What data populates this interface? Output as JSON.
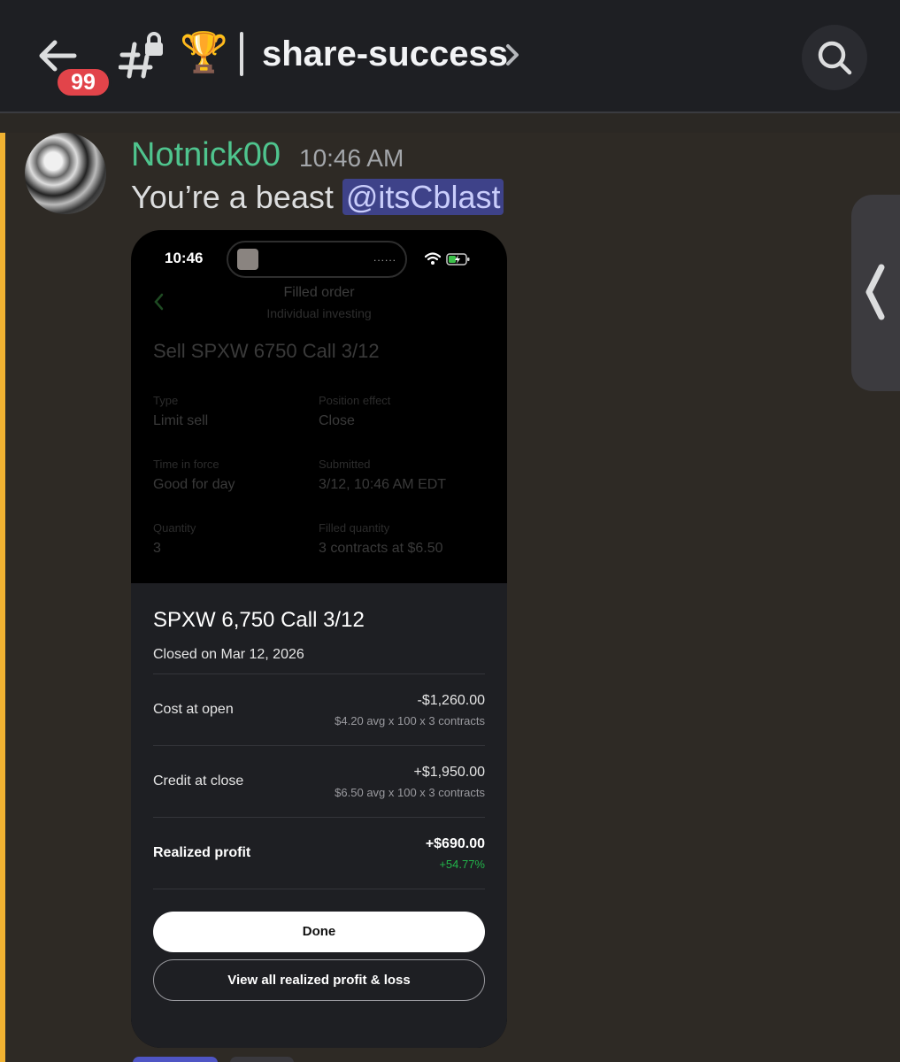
{
  "header": {
    "unread_badge": "99",
    "trophy_emoji": "🏆",
    "channel_name": "share-success",
    "icons": [
      "arrow-left-icon",
      "locked-channel-hash-icon",
      "chevron-right-icon",
      "search-icon"
    ]
  },
  "message": {
    "author": "Notnick00",
    "author_color": "#4fc48e",
    "timestamp": "10:46 AM",
    "text": "You’re a beast",
    "mention": "@itsCblast"
  },
  "attachment": {
    "status_time": "10:46",
    "island_dots": "......",
    "order": {
      "title": "Filled order",
      "subtitle": "Individual investing",
      "heading": "Sell SPXW 6750 Call 3/12",
      "fields": [
        {
          "label": "Type",
          "value": "Limit sell"
        },
        {
          "label": "Position effect",
          "value": "Close"
        },
        {
          "label": "Time in force",
          "value": "Good for day"
        },
        {
          "label": "Submitted",
          "value": "3/12, 10:46 AM EDT"
        },
        {
          "label": "Quantity",
          "value": "3"
        },
        {
          "label": "Filled quantity",
          "value": "3 contracts at $6.50"
        }
      ]
    },
    "sheet": {
      "title": "SPXW 6,750 Call 3/12",
      "closed_on": "Closed on Mar 12, 2026",
      "rows": [
        {
          "label": "Cost at open",
          "amount": "-$1,260.00",
          "detail": "$4.20 avg x 100 x 3 contracts"
        },
        {
          "label": "Credit at close",
          "amount": "+$1,950.00",
          "detail": "$6.50 avg x 100 x 3 contracts"
        },
        {
          "label": "Realized profit",
          "amount": "+$690.00",
          "detail": "+54.77%"
        }
      ],
      "done_label": "Done",
      "view_pl_label": "View all realized profit & loss",
      "profit_color": "#22b44a"
    }
  },
  "colors": {
    "highlight_bar": "#f0b232",
    "badge": "#e2444a",
    "mention_bg": "#3e4289"
  }
}
